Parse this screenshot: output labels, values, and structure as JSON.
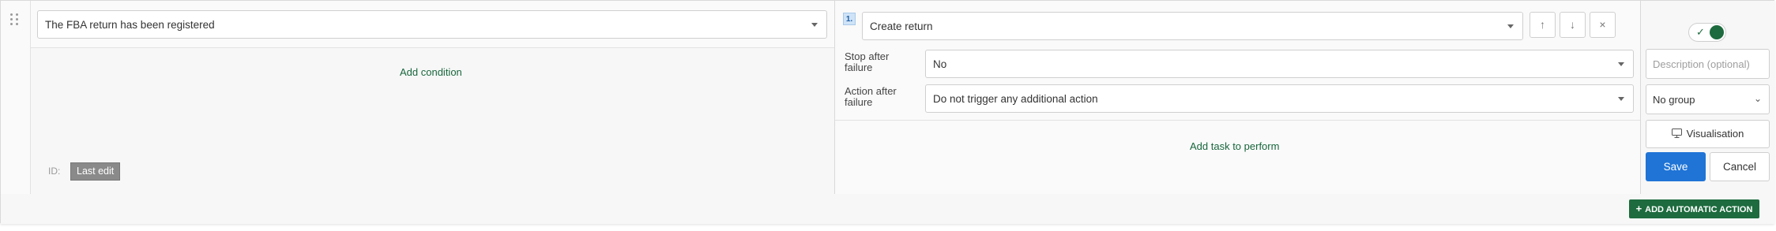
{
  "condition": {
    "trigger_value": "The FBA return has been registered",
    "add_condition_label": "Add condition",
    "id_label": "ID:",
    "last_edit_label": "Last edit"
  },
  "action": {
    "step_number": "1.",
    "action_value": "Create return",
    "stop_after_failure_label": "Stop after failure",
    "stop_after_failure_value": "No",
    "action_after_failure_label": "Action after failure",
    "action_after_failure_value": "Do not trigger any additional action",
    "add_task_label": "Add task to perform"
  },
  "side": {
    "toggle_enabled": true,
    "description_placeholder": "Description (optional)",
    "group_value": "No group",
    "visualisation_label": "Visualisation",
    "save_label": "Save",
    "cancel_label": "Cancel"
  },
  "footer": {
    "add_automatic_action_label": "ADD AUTOMATIC ACTION"
  },
  "colors": {
    "accent_green": "#1d6b3e",
    "primary_blue": "#1f74d6"
  },
  "icons": [
    "drag-handle-icon",
    "caret-down-icon",
    "arrow-up-icon",
    "arrow-down-icon",
    "close-icon",
    "check-icon",
    "chevron-down-icon",
    "monitor-icon",
    "plus-icon"
  ]
}
